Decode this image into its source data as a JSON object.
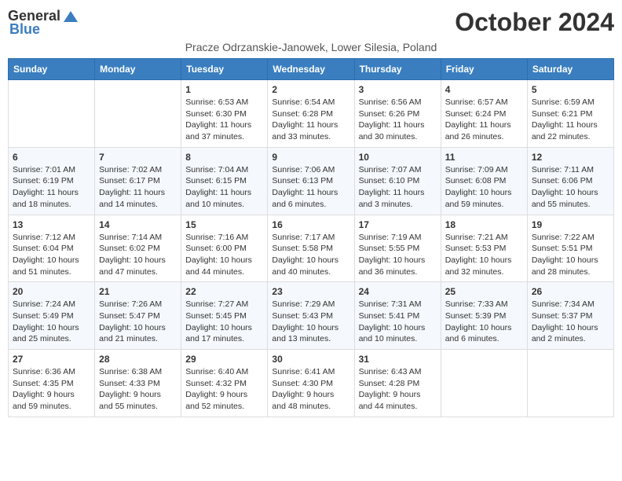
{
  "logo": {
    "general": "General",
    "blue": "Blue"
  },
  "title": "October 2024",
  "subtitle": "Pracze Odrzanskie-Janowek, Lower Silesia, Poland",
  "days_of_week": [
    "Sunday",
    "Monday",
    "Tuesday",
    "Wednesday",
    "Thursday",
    "Friday",
    "Saturday"
  ],
  "weeks": [
    [
      {
        "day": "",
        "sunrise": "",
        "sunset": "",
        "daylight": ""
      },
      {
        "day": "",
        "sunrise": "",
        "sunset": "",
        "daylight": ""
      },
      {
        "day": "1",
        "sunrise": "Sunrise: 6:53 AM",
        "sunset": "Sunset: 6:30 PM",
        "daylight": "Daylight: 11 hours and 37 minutes."
      },
      {
        "day": "2",
        "sunrise": "Sunrise: 6:54 AM",
        "sunset": "Sunset: 6:28 PM",
        "daylight": "Daylight: 11 hours and 33 minutes."
      },
      {
        "day": "3",
        "sunrise": "Sunrise: 6:56 AM",
        "sunset": "Sunset: 6:26 PM",
        "daylight": "Daylight: 11 hours and 30 minutes."
      },
      {
        "day": "4",
        "sunrise": "Sunrise: 6:57 AM",
        "sunset": "Sunset: 6:24 PM",
        "daylight": "Daylight: 11 hours and 26 minutes."
      },
      {
        "day": "5",
        "sunrise": "Sunrise: 6:59 AM",
        "sunset": "Sunset: 6:21 PM",
        "daylight": "Daylight: 11 hours and 22 minutes."
      }
    ],
    [
      {
        "day": "6",
        "sunrise": "Sunrise: 7:01 AM",
        "sunset": "Sunset: 6:19 PM",
        "daylight": "Daylight: 11 hours and 18 minutes."
      },
      {
        "day": "7",
        "sunrise": "Sunrise: 7:02 AM",
        "sunset": "Sunset: 6:17 PM",
        "daylight": "Daylight: 11 hours and 14 minutes."
      },
      {
        "day": "8",
        "sunrise": "Sunrise: 7:04 AM",
        "sunset": "Sunset: 6:15 PM",
        "daylight": "Daylight: 11 hours and 10 minutes."
      },
      {
        "day": "9",
        "sunrise": "Sunrise: 7:06 AM",
        "sunset": "Sunset: 6:13 PM",
        "daylight": "Daylight: 11 hours and 6 minutes."
      },
      {
        "day": "10",
        "sunrise": "Sunrise: 7:07 AM",
        "sunset": "Sunset: 6:10 PM",
        "daylight": "Daylight: 11 hours and 3 minutes."
      },
      {
        "day": "11",
        "sunrise": "Sunrise: 7:09 AM",
        "sunset": "Sunset: 6:08 PM",
        "daylight": "Daylight: 10 hours and 59 minutes."
      },
      {
        "day": "12",
        "sunrise": "Sunrise: 7:11 AM",
        "sunset": "Sunset: 6:06 PM",
        "daylight": "Daylight: 10 hours and 55 minutes."
      }
    ],
    [
      {
        "day": "13",
        "sunrise": "Sunrise: 7:12 AM",
        "sunset": "Sunset: 6:04 PM",
        "daylight": "Daylight: 10 hours and 51 minutes."
      },
      {
        "day": "14",
        "sunrise": "Sunrise: 7:14 AM",
        "sunset": "Sunset: 6:02 PM",
        "daylight": "Daylight: 10 hours and 47 minutes."
      },
      {
        "day": "15",
        "sunrise": "Sunrise: 7:16 AM",
        "sunset": "Sunset: 6:00 PM",
        "daylight": "Daylight: 10 hours and 44 minutes."
      },
      {
        "day": "16",
        "sunrise": "Sunrise: 7:17 AM",
        "sunset": "Sunset: 5:58 PM",
        "daylight": "Daylight: 10 hours and 40 minutes."
      },
      {
        "day": "17",
        "sunrise": "Sunrise: 7:19 AM",
        "sunset": "Sunset: 5:55 PM",
        "daylight": "Daylight: 10 hours and 36 minutes."
      },
      {
        "day": "18",
        "sunrise": "Sunrise: 7:21 AM",
        "sunset": "Sunset: 5:53 PM",
        "daylight": "Daylight: 10 hours and 32 minutes."
      },
      {
        "day": "19",
        "sunrise": "Sunrise: 7:22 AM",
        "sunset": "Sunset: 5:51 PM",
        "daylight": "Daylight: 10 hours and 28 minutes."
      }
    ],
    [
      {
        "day": "20",
        "sunrise": "Sunrise: 7:24 AM",
        "sunset": "Sunset: 5:49 PM",
        "daylight": "Daylight: 10 hours and 25 minutes."
      },
      {
        "day": "21",
        "sunrise": "Sunrise: 7:26 AM",
        "sunset": "Sunset: 5:47 PM",
        "daylight": "Daylight: 10 hours and 21 minutes."
      },
      {
        "day": "22",
        "sunrise": "Sunrise: 7:27 AM",
        "sunset": "Sunset: 5:45 PM",
        "daylight": "Daylight: 10 hours and 17 minutes."
      },
      {
        "day": "23",
        "sunrise": "Sunrise: 7:29 AM",
        "sunset": "Sunset: 5:43 PM",
        "daylight": "Daylight: 10 hours and 13 minutes."
      },
      {
        "day": "24",
        "sunrise": "Sunrise: 7:31 AM",
        "sunset": "Sunset: 5:41 PM",
        "daylight": "Daylight: 10 hours and 10 minutes."
      },
      {
        "day": "25",
        "sunrise": "Sunrise: 7:33 AM",
        "sunset": "Sunset: 5:39 PM",
        "daylight": "Daylight: 10 hours and 6 minutes."
      },
      {
        "day": "26",
        "sunrise": "Sunrise: 7:34 AM",
        "sunset": "Sunset: 5:37 PM",
        "daylight": "Daylight: 10 hours and 2 minutes."
      }
    ],
    [
      {
        "day": "27",
        "sunrise": "Sunrise: 6:36 AM",
        "sunset": "Sunset: 4:35 PM",
        "daylight": "Daylight: 9 hours and 59 minutes."
      },
      {
        "day": "28",
        "sunrise": "Sunrise: 6:38 AM",
        "sunset": "Sunset: 4:33 PM",
        "daylight": "Daylight: 9 hours and 55 minutes."
      },
      {
        "day": "29",
        "sunrise": "Sunrise: 6:40 AM",
        "sunset": "Sunset: 4:32 PM",
        "daylight": "Daylight: 9 hours and 52 minutes."
      },
      {
        "day": "30",
        "sunrise": "Sunrise: 6:41 AM",
        "sunset": "Sunset: 4:30 PM",
        "daylight": "Daylight: 9 hours and 48 minutes."
      },
      {
        "day": "31",
        "sunrise": "Sunrise: 6:43 AM",
        "sunset": "Sunset: 4:28 PM",
        "daylight": "Daylight: 9 hours and 44 minutes."
      },
      {
        "day": "",
        "sunrise": "",
        "sunset": "",
        "daylight": ""
      },
      {
        "day": "",
        "sunrise": "",
        "sunset": "",
        "daylight": ""
      }
    ]
  ]
}
